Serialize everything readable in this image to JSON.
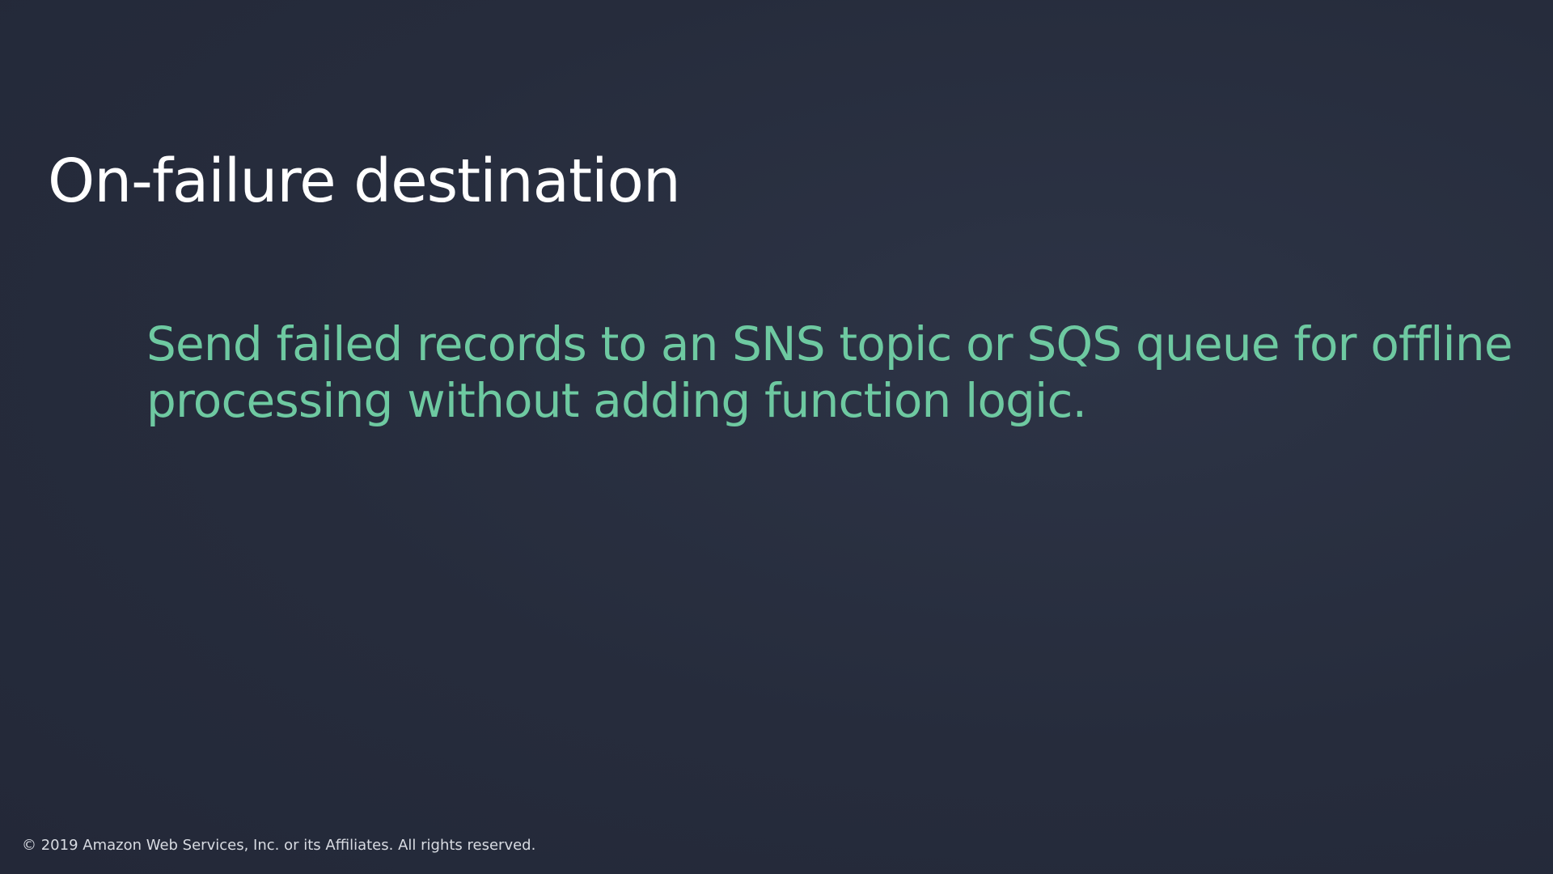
{
  "slide": {
    "title": "On-failure destination",
    "body": "Send failed records to an SNS topic or SQS queue for offline processing without adding function logic.",
    "footer": "© 2019 Amazon Web Services, Inc. or its Affiliates. All rights reserved."
  },
  "colors": {
    "background": "#262c3c",
    "title": "#ffffff",
    "body": "#6ec9a1",
    "footer": "#d8dbe2"
  }
}
